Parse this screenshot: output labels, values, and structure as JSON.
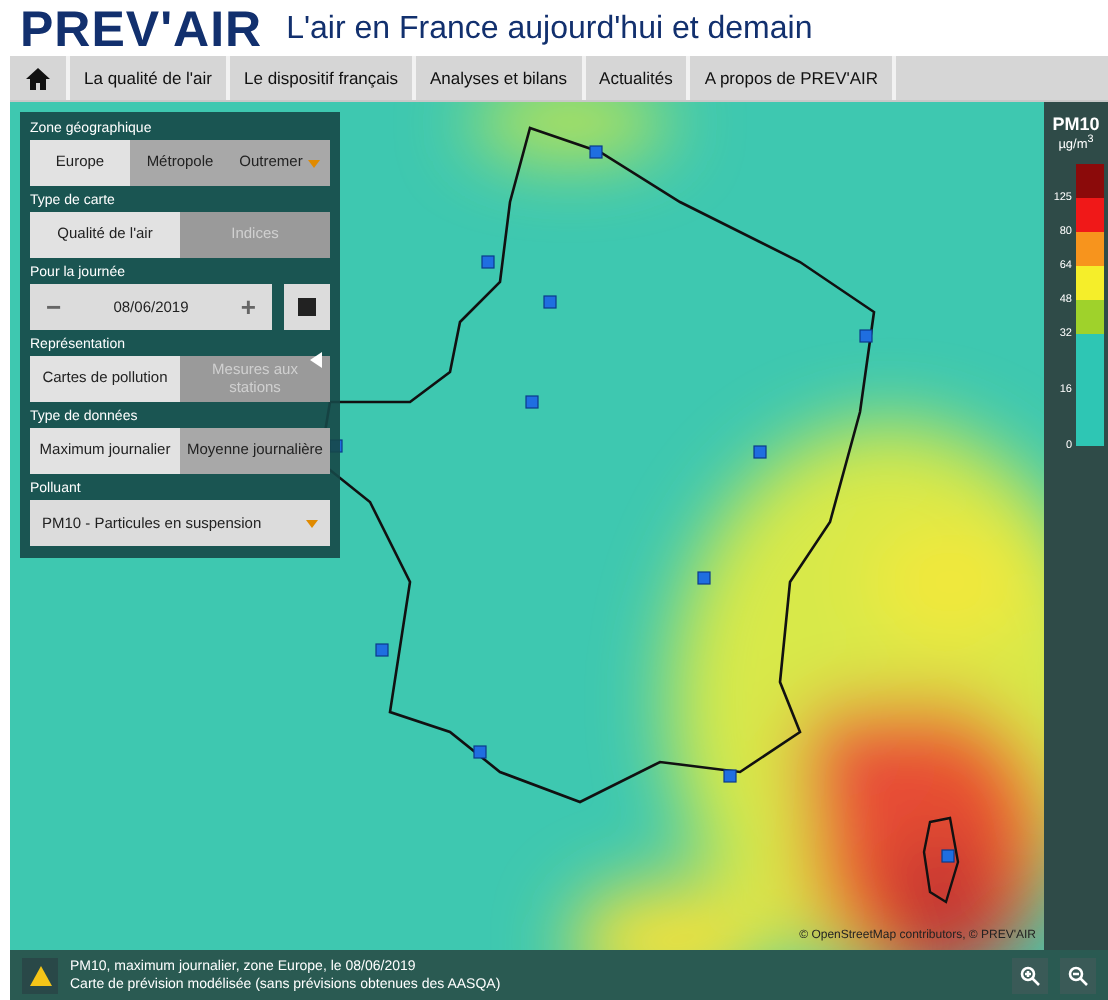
{
  "header": {
    "logo": "PREV'AIR",
    "tagline": "L'air en France aujourd'hui et demain"
  },
  "nav": {
    "items": [
      {
        "label": "La qualité de l'air"
      },
      {
        "label": "Le dispositif français"
      },
      {
        "label": "Analyses et bilans"
      },
      {
        "label": "Actualités"
      },
      {
        "label": "A propos de PREV'AIR"
      }
    ]
  },
  "sidebar": {
    "sections": [
      {
        "kind": "segmented",
        "label": "Zone géographique",
        "options": [
          {
            "label": "Europe",
            "selected": true,
            "disabled": false,
            "dropdown": false
          },
          {
            "label": "Métropole",
            "selected": false,
            "disabled": false,
            "dropdown": false
          },
          {
            "label": "Outremer",
            "selected": false,
            "disabled": false,
            "dropdown": true
          }
        ]
      },
      {
        "kind": "segmented",
        "label": "Type de carte",
        "options": [
          {
            "label": "Qualité de l'air",
            "selected": true,
            "disabled": false,
            "dropdown": false
          },
          {
            "label": "Indices",
            "selected": false,
            "disabled": true,
            "dropdown": false
          }
        ]
      },
      {
        "kind": "date",
        "label": "Pour la journée",
        "minus": "−",
        "value": "08/06/2019",
        "plus": "+"
      },
      {
        "kind": "segmented",
        "label": "Représentation",
        "options": [
          {
            "label": "Cartes de pollution",
            "selected": true,
            "disabled": false,
            "dropdown": false
          },
          {
            "label": "Mesures aux stations",
            "selected": false,
            "disabled": true,
            "dropdown": false
          }
        ]
      },
      {
        "kind": "segmented",
        "label": "Type de données",
        "options": [
          {
            "label": "Maximum journalier",
            "selected": true,
            "disabled": false,
            "dropdown": false
          },
          {
            "label": "Moyenne journalière",
            "selected": false,
            "disabled": false,
            "dropdown": false
          }
        ]
      },
      {
        "kind": "select",
        "label": "Polluant",
        "value": "PM10 - Particules en suspension"
      }
    ]
  },
  "legend": {
    "title": "PM10",
    "unit": "µg/m$^{3}$",
    "bands": [
      {
        "color": "#8b0a0a",
        "label": "125"
      },
      {
        "color": "#f01818",
        "label": "80"
      },
      {
        "color": "#f7941d",
        "label": "64"
      },
      {
        "color": "#f5ee2a",
        "label": "48"
      },
      {
        "color": "#9fd22b",
        "label": "32"
      },
      {
        "color": "#2ec6b4",
        "label": "16"
      },
      {
        "color": "#2ec6b4",
        "label": "0"
      }
    ]
  },
  "map": {
    "attribution": "© OpenStreetMap contributors, © PREV'AIR"
  },
  "info": {
    "title": "PM10, maximum journalier, zone Europe, le 08/06/2019",
    "description": "Carte de prévision modélisée (sans prévisions obtenues des AASQA)"
  }
}
